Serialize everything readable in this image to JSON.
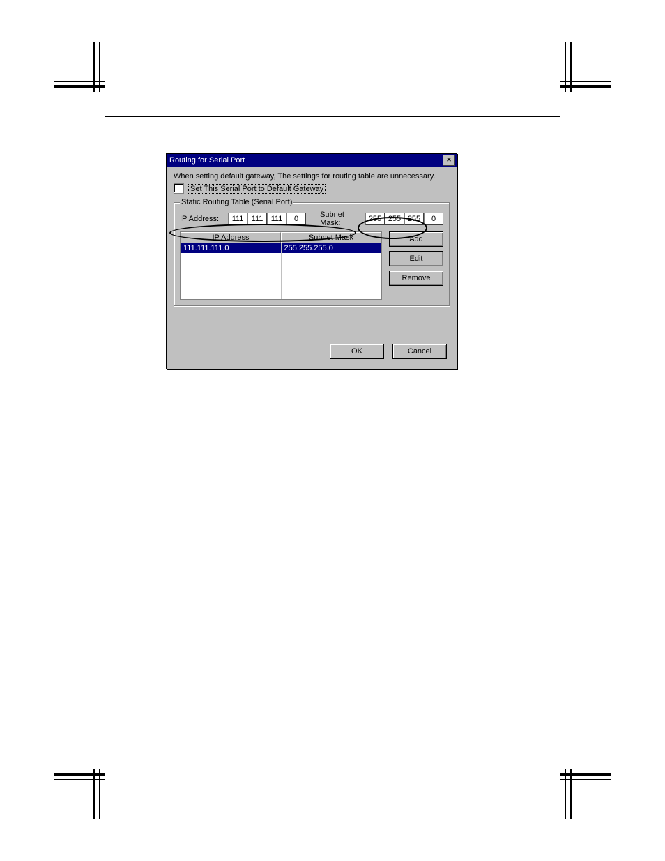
{
  "dialog": {
    "title": "Routing for Serial Port",
    "hint": "When setting default gateway, The settings for routing table are unnecessary.",
    "checkbox_label": "Set This Serial Port to Default Gateway",
    "group_legend": "Static Routing Table (Serial Port)",
    "ip_label": "IP Address:",
    "subnet_label": "Subnet Mask:",
    "ip_octets": [
      "111",
      "111",
      "111",
      "0"
    ],
    "subnet_octets": [
      "255",
      "255",
      "255",
      "0"
    ],
    "columns": [
      "IP Address",
      "Subnet Mask"
    ],
    "rows": [
      {
        "ip": "111.111.111.0",
        "mask": "255.255.255.0",
        "selected": true
      }
    ],
    "buttons": {
      "add": "Add",
      "edit": "Edit",
      "remove": "Remove",
      "ok": "OK",
      "cancel": "Cancel"
    }
  }
}
